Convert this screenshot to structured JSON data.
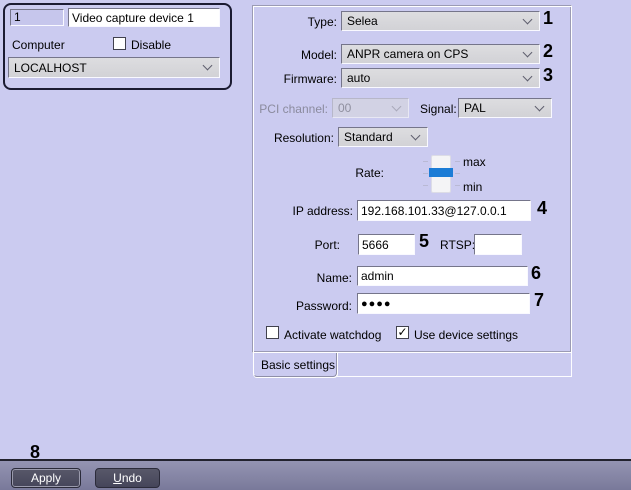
{
  "icons": {
    "chevron_down": "v",
    "checkmark": "✓"
  },
  "device_panel": {
    "id_value": "1",
    "name_value": "Video capture device 1",
    "computer_label": "Computer",
    "disable_label": "Disable",
    "computer_value": "LOCALHOST"
  },
  "settings_panel": {
    "tab_label": "Basic settings",
    "type_label": "Type:",
    "type_value": "Selea",
    "model_label": "Model:",
    "model_value": "ANPR camera on CPS",
    "firmware_label": "Firmware:",
    "firmware_value": "auto",
    "pci_channel_label": "PCI channel:",
    "pci_channel_value": "00",
    "signal_label": "Signal:",
    "signal_value": "PAL",
    "resolution_label": "Resolution:",
    "resolution_value": "Standard",
    "rate_label": "Rate:",
    "rate_max_label": "max",
    "rate_min_label": "min",
    "ip_label": "IP address:",
    "ip_value": "192.168.101.33@127.0.0.1",
    "port_label": "Port:",
    "port_value": "5666",
    "rtsp_label": "RTSP:",
    "rtsp_value": "",
    "name_label": "Name:",
    "name_value": "admin",
    "password_label": "Password:",
    "password_value": "●●●●",
    "watchdog_label": "Activate watchdog",
    "use_device_settings_label": "Use device settings"
  },
  "annotations": {
    "n1": "1",
    "n2": "2",
    "n3": "3",
    "n4": "4",
    "n5": "5",
    "n6": "6",
    "n7": "7",
    "n8": "8"
  },
  "footer": {
    "apply_label": "Apply",
    "undo_accel": "U",
    "undo_rest": "ndo"
  },
  "colors": {
    "background": "#cbcbf0",
    "slider_accent": "#1b7cd6",
    "footer_bar_top": "#9494b2",
    "footer_bar_bottom": "#79799a",
    "button_bg": "#4b4b5f",
    "combo_bg": "#d6d6d6",
    "annotation_color": "#000000"
  }
}
